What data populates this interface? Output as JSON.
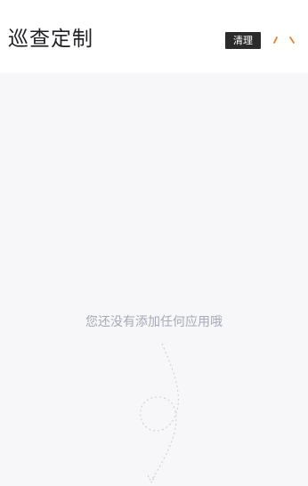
{
  "header": {
    "title": "巡查定制",
    "clear_label": "清理",
    "accent_color": "#e8812f"
  },
  "main": {
    "empty_message": "您还没有添加任何应用哦",
    "background_color": "#f7f7f9"
  },
  "icons": {
    "edit_ticks": "loading-ticks-icon",
    "decoration": "dotted-path-illustration"
  }
}
